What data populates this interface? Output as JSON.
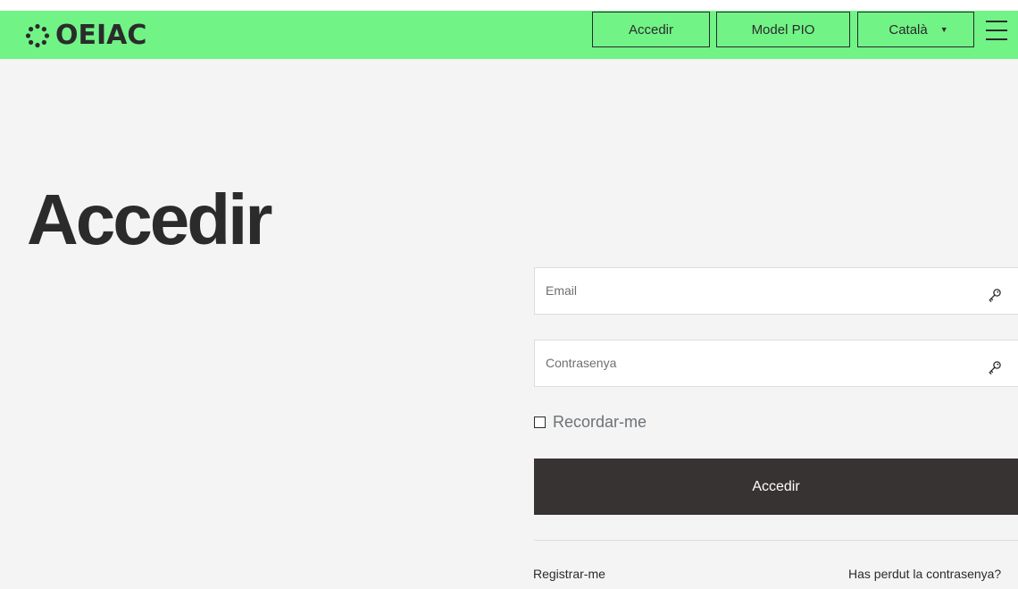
{
  "brand": {
    "name": "OEIAC",
    "logo_icon": "dotted-circle-logo-icon",
    "color": "#71f386"
  },
  "header": {
    "nav_login_label": "Accedir",
    "nav_model_label": "Model PIO",
    "language": {
      "selected": "Català",
      "caret_icon": "caret-down-icon"
    },
    "menu_icon": "hamburger-menu-icon"
  },
  "main": {
    "title": "Accedir",
    "form": {
      "email_placeholder": "Email",
      "email_value": "",
      "email_icon": "key-icon",
      "password_placeholder": "Contrasenya",
      "password_value": "",
      "password_icon": "key-icon",
      "remember_label": "Recordar-me",
      "remember_checked": false,
      "submit_label": "Accedir",
      "submit_color": "#373332"
    },
    "links": {
      "register_label": "Registrar-me",
      "forgot_label": "Has perdut la contrasenya?"
    }
  }
}
